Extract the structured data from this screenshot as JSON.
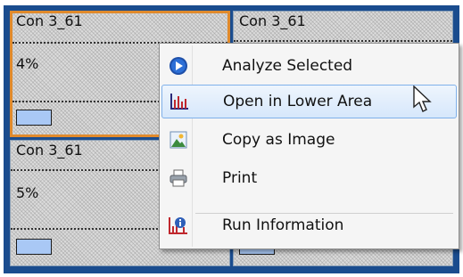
{
  "cells": [
    {
      "title": "Con 3_61",
      "value": "4%"
    },
    {
      "title": "Con 3_61",
      "value": ""
    },
    {
      "title": "Con 3_61",
      "value": "5%"
    },
    {
      "title": "",
      "value": ""
    }
  ],
  "context_menu": {
    "items": [
      {
        "label": "Analyze Selected",
        "icon": "play-circle-icon"
      },
      {
        "label": "Open in Lower Area",
        "icon": "bar-chart-icon"
      },
      {
        "label": "Copy as Image",
        "icon": "image-icon"
      },
      {
        "label": "Print",
        "icon": "printer-icon"
      },
      {
        "label": "Run Information",
        "icon": "info-chart-icon"
      }
    ]
  },
  "colors": {
    "frame": "#1a4c8e",
    "selection_border": "#e08a2c",
    "bar_fill": "#a9c8f5",
    "menu_hover": "#d6e7fb"
  }
}
